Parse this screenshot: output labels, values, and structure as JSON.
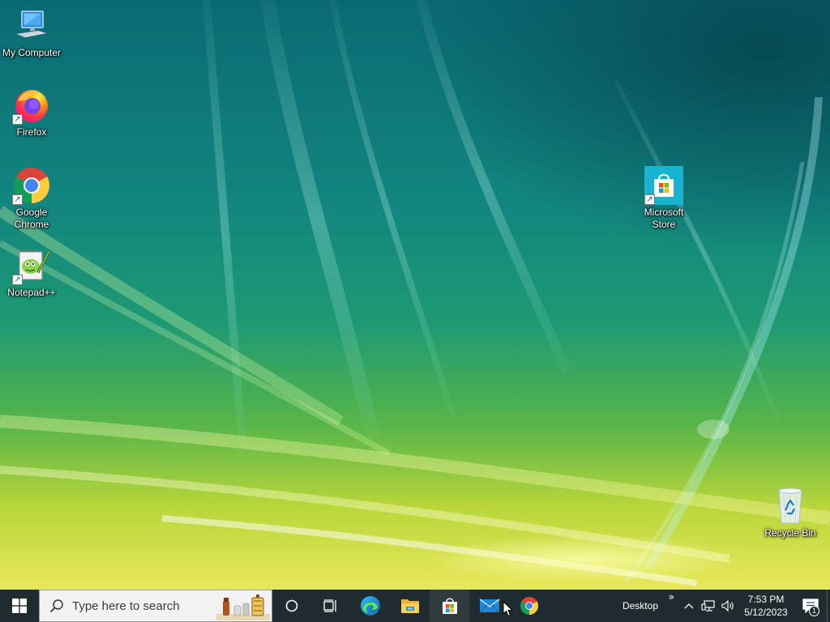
{
  "desktop": {
    "icons": [
      {
        "id": "my-computer",
        "label": "My Computer",
        "icon": "computer-icon",
        "shortcut": false
      },
      {
        "id": "firefox",
        "label": "Firefox",
        "icon": "firefox-icon",
        "shortcut": true
      },
      {
        "id": "google-chrome",
        "label": "Google Chrome",
        "icon": "chrome-icon",
        "shortcut": true
      },
      {
        "id": "notepadpp",
        "label": "Notepad++",
        "icon": "notepadpp-icon",
        "shortcut": true
      },
      {
        "id": "microsoft-store",
        "label": "Microsoft Store",
        "icon": "store-icon",
        "shortcut": true
      },
      {
        "id": "recycle-bin",
        "label": "Recycle Bin",
        "icon": "recycle-bin-icon",
        "shortcut": false
      }
    ],
    "shortcut_glyph": "↗"
  },
  "taskbar": {
    "start_icon": "windows-logo-icon",
    "search": {
      "placeholder": "Type here to search",
      "icon": "search-icon"
    },
    "cortana_icon": "cortana-circle-icon",
    "task_view_icon": "task-view-icon",
    "pinned_apps": [
      {
        "name": "Microsoft Edge",
        "icon": "edge-icon"
      },
      {
        "name": "File Explorer",
        "icon": "file-explorer-icon"
      },
      {
        "name": "Microsoft Store",
        "icon": "store-icon"
      },
      {
        "name": "Mail",
        "icon": "mail-icon"
      },
      {
        "name": "Google Chrome",
        "icon": "chrome-icon"
      }
    ],
    "desktop_toolbar": {
      "label": "Desktop",
      "chevron": "»"
    },
    "tray": {
      "show_hidden_icon": "chevron-up-icon",
      "network_icon": "network-icon",
      "volume_icon": "volume-icon"
    },
    "clock": {
      "time": "7:53 PM",
      "date": "5/12/2023"
    },
    "notifications": {
      "icon": "action-center-icon",
      "count": "1"
    }
  },
  "colors": {
    "taskbar": "#1f2b2e",
    "wallpaper_top": "#0a6a74",
    "wallpaper_bottom": "#e8e85a",
    "accent": "#0078d7"
  }
}
